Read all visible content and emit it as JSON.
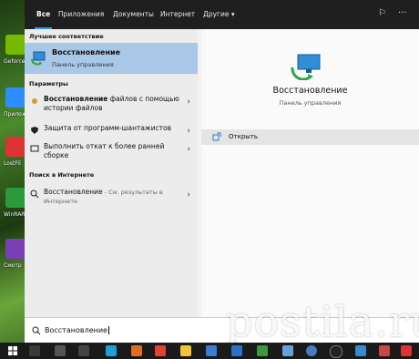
{
  "tabs": [
    "Все",
    "Приложения",
    "Документы",
    "Интернет",
    "Другие"
  ],
  "sections": {
    "best": "Лучшее соответствие",
    "params": "Параметры",
    "web": "Поиск в Интернете"
  },
  "best_match": {
    "title": "Восстановление",
    "subtitle": "Панель управления"
  },
  "settings": [
    {
      "bold": "Восстановление",
      "text": " файлов с помощью истории файлов"
    },
    {
      "bold": "",
      "text": "Защита от программ-шантажистов"
    },
    {
      "bold": "",
      "text": "Выполнить откат к более ранней сборке"
    }
  ],
  "web_result": {
    "bold": "Восстановление",
    "text": " - См. результаты в Интернете"
  },
  "detail": {
    "title": "Восстановление",
    "subtitle": "Панель управления",
    "open": "Открыть"
  },
  "search": {
    "value": "Восстановление"
  },
  "desktop_labels": [
    "Geforce Experien",
    "Приложение сервис",
    "LostFil",
    "WinRAR",
    "Смотр"
  ],
  "watermark": "postila.ru",
  "colors": {
    "accent": "#3c8ef0",
    "selected": "#a9c7e6"
  }
}
